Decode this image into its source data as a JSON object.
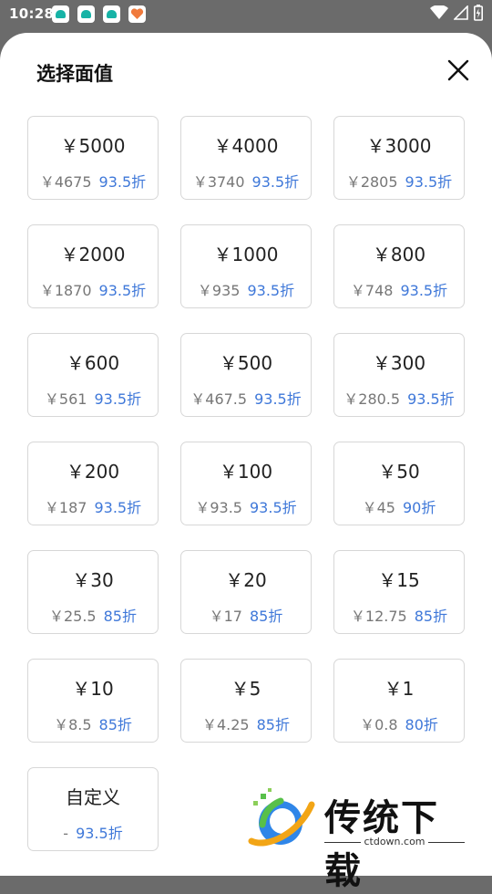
{
  "status_bar": {
    "time": "10:28"
  },
  "sheet": {
    "title": "选择面值"
  },
  "options": [
    {
      "face": "￥5000",
      "price": "￥4675",
      "discount": "93.5折"
    },
    {
      "face": "￥4000",
      "price": "￥3740",
      "discount": "93.5折"
    },
    {
      "face": "￥3000",
      "price": "￥2805",
      "discount": "93.5折"
    },
    {
      "face": "￥2000",
      "price": "￥1870",
      "discount": "93.5折"
    },
    {
      "face": "￥1000",
      "price": "￥935",
      "discount": "93.5折"
    },
    {
      "face": "￥800",
      "price": "￥748",
      "discount": "93.5折"
    },
    {
      "face": "￥600",
      "price": "￥561",
      "discount": "93.5折"
    },
    {
      "face": "￥500",
      "price": "￥467.5",
      "discount": "93.5折"
    },
    {
      "face": "￥300",
      "price": "￥280.5",
      "discount": "93.5折"
    },
    {
      "face": "￥200",
      "price": "￥187",
      "discount": "93.5折"
    },
    {
      "face": "￥100",
      "price": "￥93.5",
      "discount": "93.5折"
    },
    {
      "face": "￥50",
      "price": "￥45",
      "discount": "90折"
    },
    {
      "face": "￥30",
      "price": "￥25.5",
      "discount": "85折"
    },
    {
      "face": "￥20",
      "price": "￥17",
      "discount": "85折"
    },
    {
      "face": "￥15",
      "price": "￥12.75",
      "discount": "85折"
    },
    {
      "face": "￥10",
      "price": "￥8.5",
      "discount": "85折"
    },
    {
      "face": "￥5",
      "price": "￥4.25",
      "discount": "85折"
    },
    {
      "face": "￥1",
      "price": "￥0.8",
      "discount": "80折"
    },
    {
      "face": "自定义",
      "price": "-",
      "discount": "93.5折"
    }
  ],
  "watermark": {
    "text": "传统下载",
    "url": "ctdown.com"
  },
  "colors": {
    "discount": "#3f78d9",
    "price": "#777777",
    "border": "#d7d7d7"
  }
}
